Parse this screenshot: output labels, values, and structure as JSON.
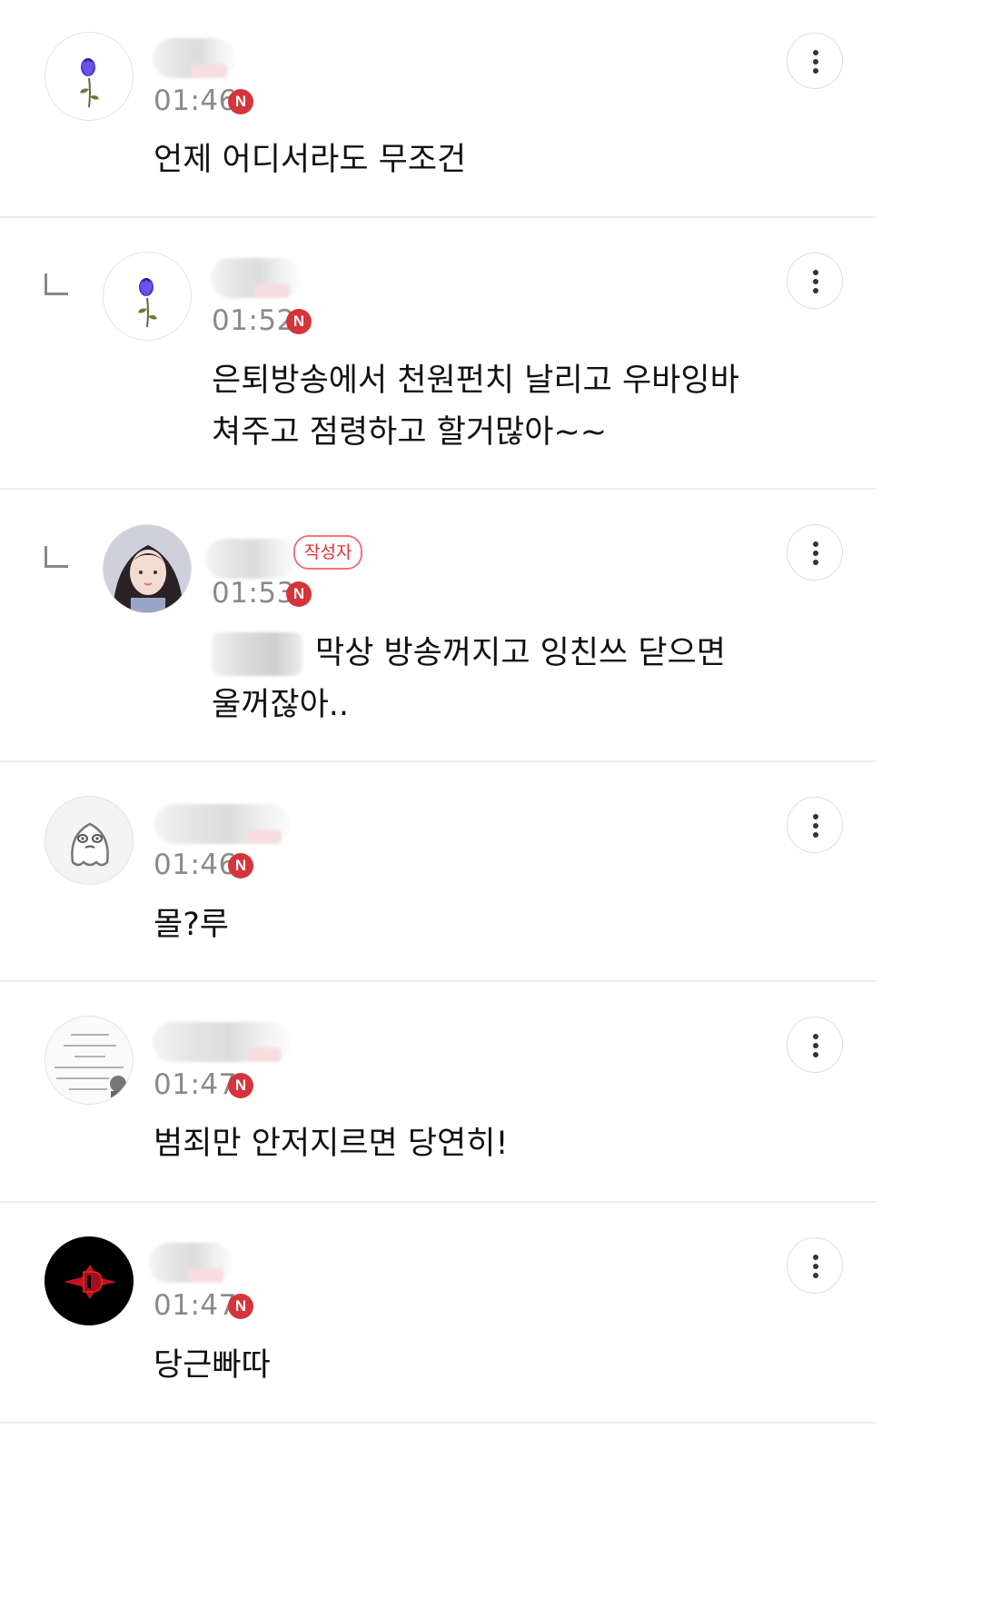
{
  "comments": [
    {
      "time": "01:46",
      "badge": "N",
      "text": "언제 어디서라도 무조건",
      "avatar_icon": "rose-icon",
      "reply": false
    },
    {
      "time": "01:52",
      "badge": "N",
      "text_line1": "은퇴방송에서 천원펀치 날리고 우바잉바",
      "text_line2": "쳐주고 점령하고 할거많아~~",
      "avatar_icon": "rose-icon",
      "reply": true
    },
    {
      "time": "01:53",
      "badge": "N",
      "author_label": "작성자",
      "text_line1": "막상 방송꺼지고 잉친쓰 닫으면",
      "text_line2": "울꺼잖아..",
      "avatar_icon": "profile-photo-girl",
      "reply": true
    },
    {
      "time": "01:46",
      "badge": "N",
      "text": "몰?루",
      "avatar_icon": "ghost-character-icon",
      "reply": false
    },
    {
      "time": "01:47",
      "badge": "N",
      "text": "범죄만 안저지르면 당연히!",
      "avatar_icon": "quote-text-image",
      "reply": false
    },
    {
      "time": "01:47",
      "badge": "N",
      "text": "당근빠따",
      "avatar_icon": "red-d-logo-icon",
      "reply": false
    }
  ],
  "colors": {
    "new_badge": "#d5343a",
    "author_badge": "#dd3333",
    "divider": "#ececec",
    "time": "#8a8a8a"
  },
  "icons": {
    "more": "more-vertical-icon",
    "reply": "reply-corner-icon"
  }
}
